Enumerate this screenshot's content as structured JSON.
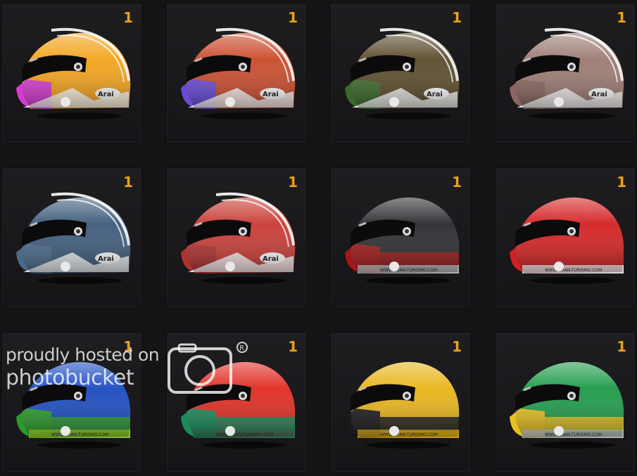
{
  "helmets": [
    {
      "count": "1",
      "shell": "#f3a21a",
      "accent": "#d63bd0",
      "stripe": "#ffffff",
      "style": "arai"
    },
    {
      "count": "1",
      "shell": "#c94a2a",
      "accent": "#6a4ad8",
      "stripe": "#ffffff",
      "style": "arai"
    },
    {
      "count": "1",
      "shell": "#5a4a2a",
      "accent": "#3c6a2a",
      "stripe": "#ffffff",
      "style": "arai"
    },
    {
      "count": "1",
      "shell": "#9a7a72",
      "accent": "#8a6660",
      "stripe": "#ffffff",
      "style": "arai"
    },
    {
      "count": "1",
      "shell": "#3c5a7a",
      "accent": "#4a6a8a",
      "stripe": "#ffffff",
      "style": "arai"
    },
    {
      "count": "1",
      "shell": "#c83a32",
      "accent": "#b03030",
      "stripe": "#ffffff",
      "style": "arai"
    },
    {
      "count": "1",
      "shell": "#2a2a2e",
      "accent": "#a0181a",
      "stripe": "#cccccc",
      "style": "gt"
    },
    {
      "count": "1",
      "shell": "#d42020",
      "accent": "#d42020",
      "stripe": "#ffffff",
      "style": "gt"
    },
    {
      "count": "1",
      "shell": "#1a4ac0",
      "accent": "#2a9a2a",
      "stripe": "#9adf20",
      "style": "gt"
    },
    {
      "count": "1",
      "shell": "#e02a20",
      "accent": "#1a8a5a",
      "stripe": "#2a7a5a",
      "style": "gt"
    },
    {
      "count": "1",
      "shell": "#e8b418",
      "accent": "#1a1a1a",
      "stripe": "#e8b418",
      "style": "gt"
    },
    {
      "count": "1",
      "shell": "#1c9a48",
      "accent": "#e8c020",
      "stripe": "#cccccc",
      "style": "gt"
    }
  ],
  "watermark": {
    "line1": "proudly hosted on",
    "line2": "photobucket"
  }
}
